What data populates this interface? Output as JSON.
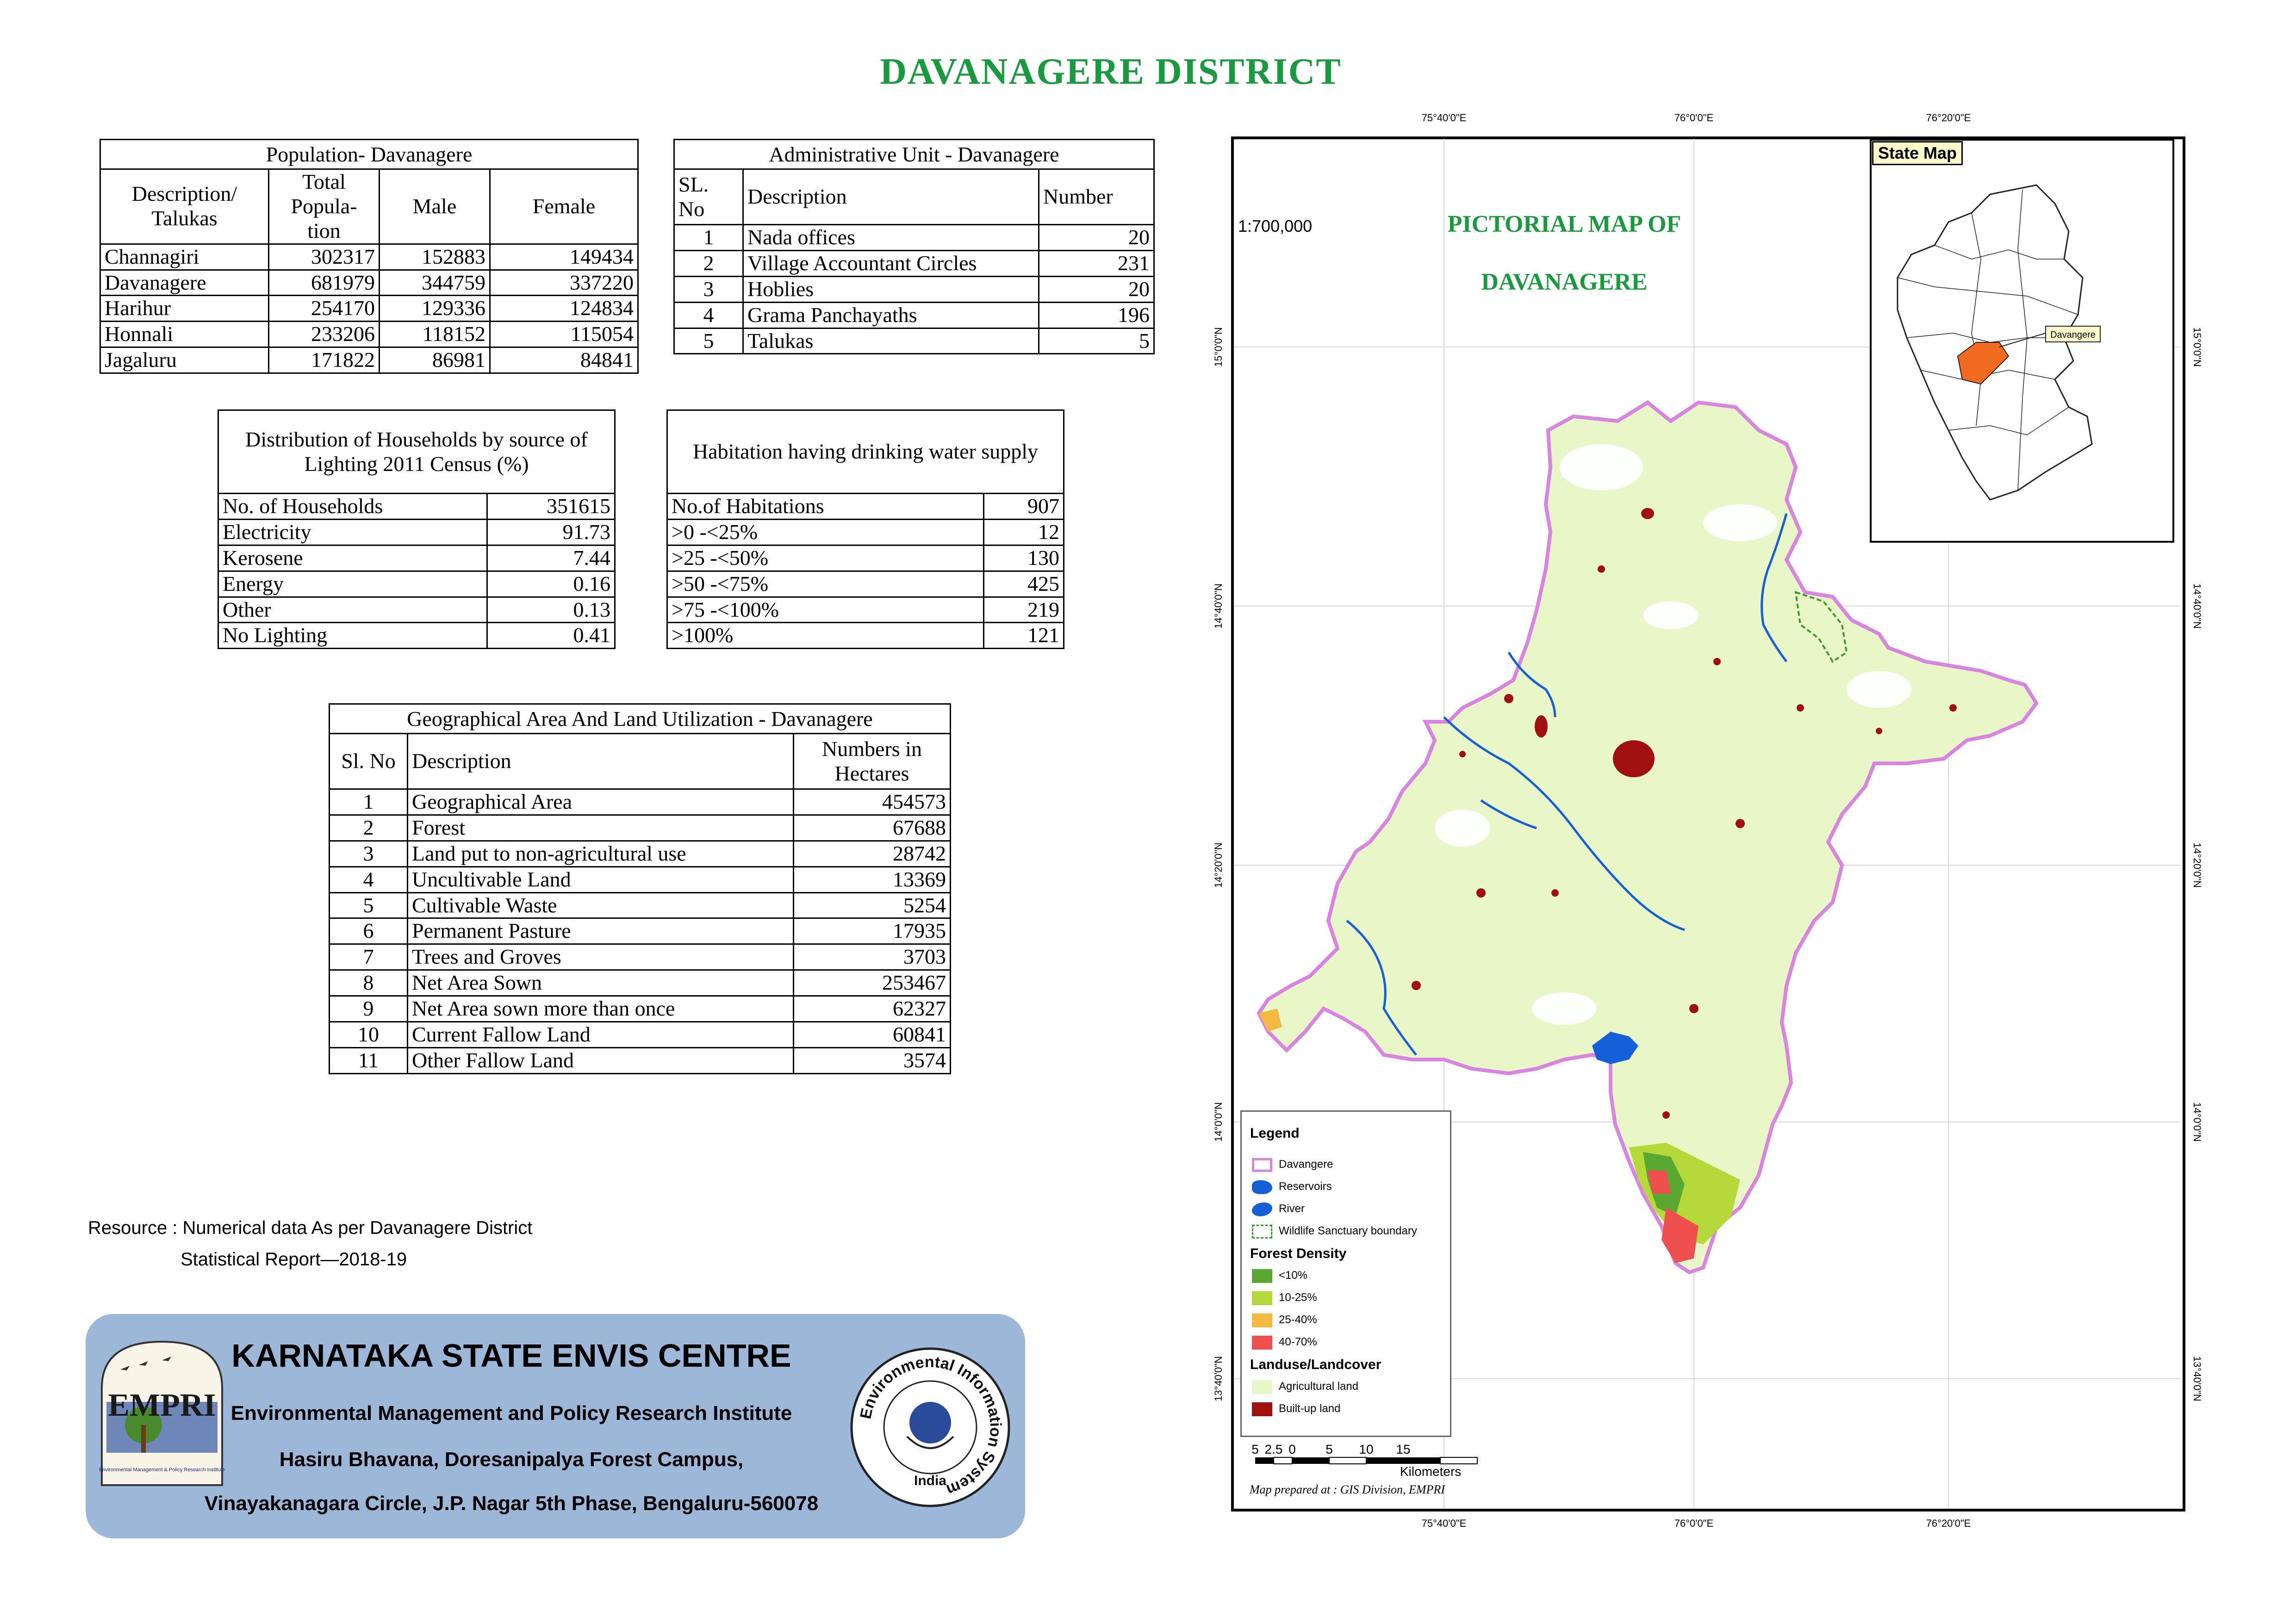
{
  "title": "DAVANAGERE DISTRICT",
  "population": {
    "caption": "Population- Davanagere",
    "headers": [
      "Description/ Talukas",
      "Total Popula- tion",
      "Male",
      "Female"
    ],
    "rows": [
      [
        "Channagiri",
        "302317",
        "152883",
        "149434"
      ],
      [
        "Davanagere",
        "681979",
        "344759",
        "337220"
      ],
      [
        "Harihur",
        "254170",
        "129336",
        "124834"
      ],
      [
        "Honnali",
        "233206",
        "118152",
        "115054"
      ],
      [
        "Jagaluru",
        "171822",
        "86981",
        "84841"
      ]
    ]
  },
  "admin": {
    "caption": "Administrative Unit - Davanagere",
    "headers": [
      "SL. No",
      "Description",
      "Number"
    ],
    "rows": [
      [
        "1",
        "Nada offices",
        "20"
      ],
      [
        "2",
        "Village Accountant Circles",
        "231"
      ],
      [
        "3",
        "Hoblies",
        "20"
      ],
      [
        "4",
        "Grama Panchayaths",
        "196"
      ],
      [
        "5",
        "Talukas",
        "5"
      ]
    ]
  },
  "households": {
    "caption": "Distribution of Households by source of Lighting 2011 Census (%)",
    "rows": [
      [
        "No. of Households",
        "351615"
      ],
      [
        "Electricity",
        "91.73"
      ],
      [
        "Kerosene",
        "7.44"
      ],
      [
        "Energy",
        "0.16"
      ],
      [
        "Other",
        "0.13"
      ],
      [
        "No Lighting",
        "0.41"
      ]
    ]
  },
  "habitation": {
    "caption": "Habitation having drinking water supply",
    "rows": [
      [
        "No.of Habitations",
        "907"
      ],
      [
        ">0 -<25%",
        "12"
      ],
      [
        ">25 -<50%",
        "130"
      ],
      [
        ">50 -<75%",
        "425"
      ],
      [
        ">75 -<100%",
        "219"
      ],
      [
        ">100%",
        "121"
      ]
    ]
  },
  "land": {
    "caption": "Geographical Area  And Land Utilization - Davanagere",
    "headers": [
      "Sl. No",
      "Description",
      "Numbers in Hectares"
    ],
    "rows": [
      [
        "1",
        "Geographical Area",
        "454573"
      ],
      [
        "2",
        "Forest",
        "67688"
      ],
      [
        "3",
        "Land put to non-agricultural use",
        "28742"
      ],
      [
        "4",
        "Uncultivable Land",
        "13369"
      ],
      [
        "5",
        "Cultivable Waste",
        "5254"
      ],
      [
        "6",
        "Permanent Pasture",
        "17935"
      ],
      [
        "7",
        "Trees and Groves",
        "3703"
      ],
      [
        "8",
        "Net Area Sown",
        "253467"
      ],
      [
        "9",
        "Net Area sown more than once",
        "62327"
      ],
      [
        "10",
        "Current Fallow Land",
        "60841"
      ],
      [
        "11",
        "Other Fallow Land",
        "3574"
      ]
    ]
  },
  "resource": {
    "line1": "Resource : Numerical data As per Davanagere District",
    "line2": "Statistical Report—2018-19"
  },
  "banner": {
    "title": "KARNATAKA STATE ENVIS CENTRE",
    "line1": "Environmental Management and Policy Research Institute",
    "line2": "Hasiru Bhavana, Doresanipalya Forest Campus,",
    "line3": "Vinayakanagara Circle, J.P. Nagar 5th Phase, Bengaluru-560078",
    "logo_left": "EMPRI",
    "logo_left_sub": "Environmental Management & Policy Research Institute",
    "logo_right_ring": "Environmental Information System",
    "logo_right_sub": "India"
  },
  "map": {
    "scale": "1:700,000",
    "title_line1": "PICTORIAL MAP OF",
    "title_line2": "DAVANAGERE",
    "lon_top": [
      "75°40'0\"E",
      "76°0'0\"E",
      "76°20'0\"E"
    ],
    "lon_bottom": [
      "75°40'0\"E",
      "76°0'0\"E",
      "76°20'0\"E"
    ],
    "lat": [
      "15°0'0\"N",
      "14°40'0\"N",
      "14°20'0\"N",
      "14°0'0\"N",
      "13°40'0\"N"
    ],
    "state_map_label": "State Map",
    "state_map_callout": "Davangere",
    "scalebar_ticks": [
      "5",
      "2.5",
      "0",
      "5",
      "10",
      "15"
    ],
    "scalebar_unit": "Kilometers",
    "credit": "Map prepared at : GIS Division, EMPRI",
    "colors": {
      "boundary": "#d884e0",
      "agri": "#e9f7c8",
      "builtup": "#a01010",
      "water": "#1560d8",
      "forest_lt10": "#5aa832",
      "forest_10_25": "#b5d83a",
      "forest_25_40": "#f4b940",
      "forest_40_70": "#f04f4f",
      "highlight": "#f26a20"
    }
  },
  "legend": {
    "title": "Legend",
    "items1": [
      "Davangere",
      "Reservoirs",
      "River",
      "Wildlife Sanctuary boundary"
    ],
    "forest_title": "Forest Density",
    "forest_items": [
      "<10%",
      "10-25%",
      "25-40%",
      "40-70%"
    ],
    "landuse_title": "Landuse/Landcover",
    "landuse_items": [
      "Agricultural land",
      "Built-up land"
    ]
  }
}
